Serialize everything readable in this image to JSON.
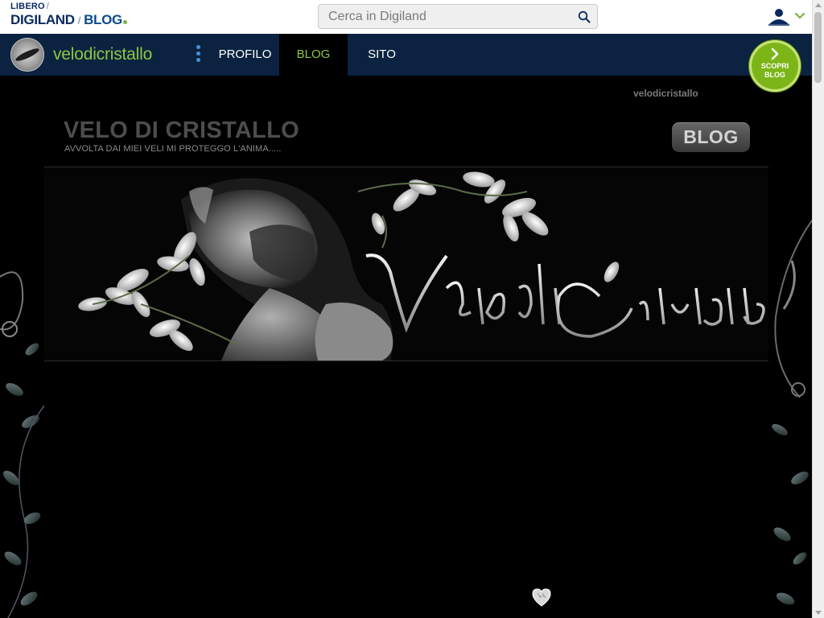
{
  "topbar": {
    "brand_line1": "LIBERO",
    "brand_line2_a": "DIGILAND",
    "brand_line2_b": "BLOG",
    "search_placeholder": "Cerca in Digiland",
    "search_icon": "search-icon",
    "user_icon": "user-icon"
  },
  "nav": {
    "username": "velodicristallo",
    "menu_icon": "more-vertical-icon",
    "tabs": [
      {
        "label": "PROFILO",
        "active": false
      },
      {
        "label": "BLOG",
        "active": true
      },
      {
        "label": "SITO",
        "active": false
      }
    ],
    "scopri": "SCOPRI BLOG"
  },
  "blog": {
    "user": "velodicristallo",
    "title": "VELO DI CRISTALLO",
    "subtitle": "AVVOLTA DAI MIEI VELI MI PROTEGGO L'ANIMA.....",
    "badge": "BLOG",
    "banner_text": "Velo di Cristallo"
  },
  "colors": {
    "nav_bg": "#0b2340",
    "accent_green": "#8dc63f",
    "brand_blue": "#0a2a5e"
  }
}
